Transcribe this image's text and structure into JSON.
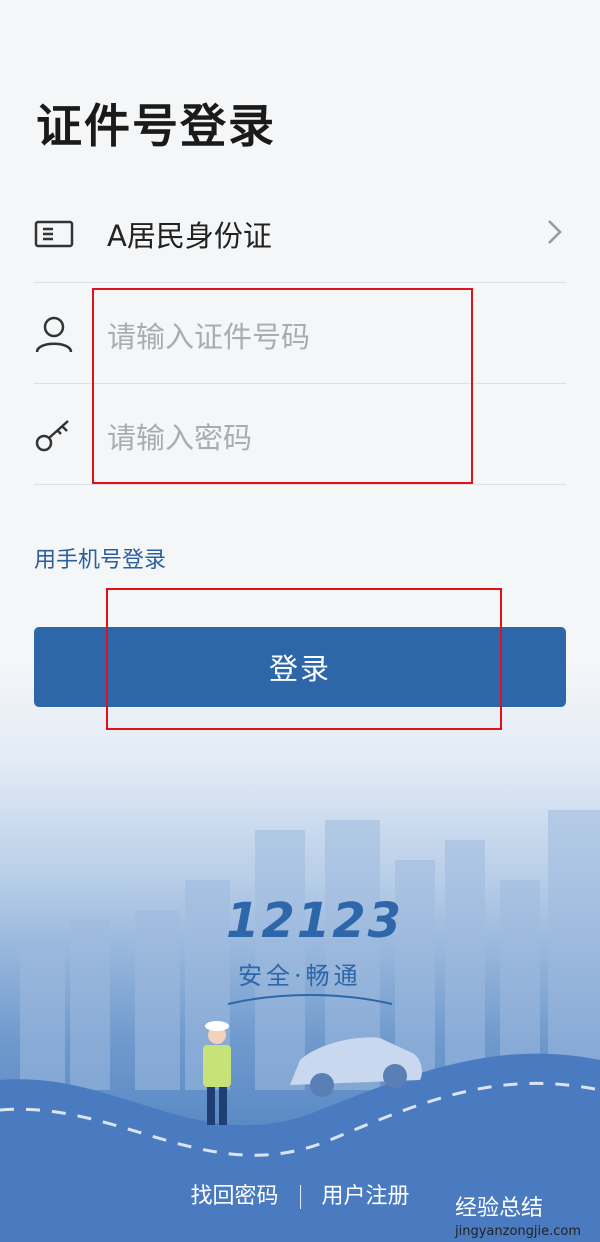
{
  "page": {
    "title": "证件号登录"
  },
  "id_type": {
    "label": "A居民身份证"
  },
  "id_number": {
    "placeholder": "请输入证件号码"
  },
  "password": {
    "placeholder": "请输入密码"
  },
  "phone_login": {
    "label": "用手机号登录"
  },
  "login_button": {
    "label": "登录"
  },
  "brand": {
    "number": "12123",
    "slogan": "安全·畅通"
  },
  "footer": {
    "recover_password": "找回密码",
    "register": "用户注册"
  },
  "watermark": {
    "text": "经验总结",
    "sub": "jingyanzongjie.com"
  },
  "colors": {
    "accent": "#2e67a9",
    "highlight": "#e0111a"
  }
}
